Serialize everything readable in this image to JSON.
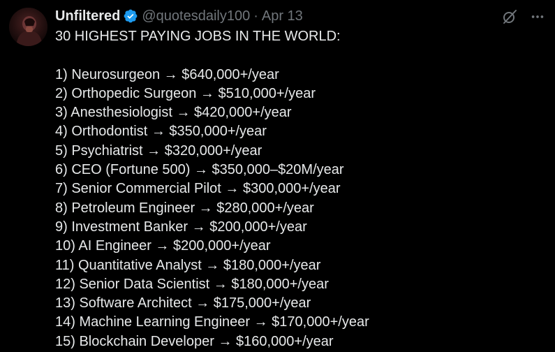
{
  "author": {
    "display_name": "Unfiltered",
    "handle": "@quotesdaily100",
    "separator": "·",
    "date": "Apr 13"
  },
  "icons": {
    "verified": "verified-badge-icon",
    "grok": "grok-icon",
    "more": "more-options-icon"
  },
  "colors": {
    "background": "#000000",
    "text": "#e7e9ea",
    "muted": "#71767b",
    "verified": "#1d9bf0"
  },
  "tweet": {
    "headline": "30 HIGHEST PAYING JOBS IN THE WORLD:",
    "items": [
      "1) Neurosurgeon → $640,000+/year",
      "2) Orthopedic Surgeon → $510,000+/year",
      "3) Anesthesiologist → $420,000+/year",
      "4) Orthodontist → $350,000+/year",
      "5) Psychiatrist → $320,000+/year",
      "6) CEO (Fortune 500) → $350,000–$20M/year",
      "7) Senior Commercial Pilot → $300,000+/year",
      "8) Petroleum Engineer → $280,000+/year",
      "9) Investment Banker → $200,000+/year",
      "10) AI Engineer → $200,000+/year",
      "11) Quantitative Analyst → $180,000+/year",
      "12) Senior Data Scientist → $180,000+/year",
      "13) Software Architect → $175,000+/year",
      "14) Machine Learning Engineer → $170,000+/year",
      "15) Blockchain Developer → $160,000+/year"
    ]
  }
}
